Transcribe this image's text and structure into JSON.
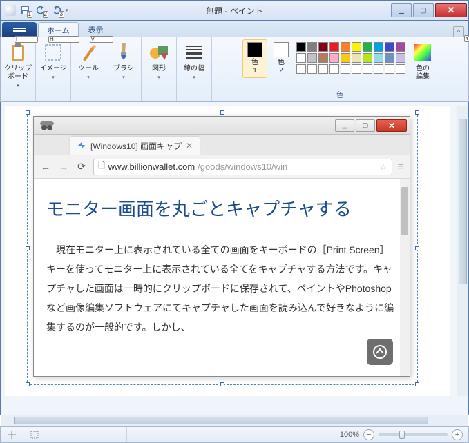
{
  "window": {
    "title": "無題 - ペイント",
    "qat": {
      "save_badge": "1",
      "undo_badge": "2",
      "redo_badge": "3"
    }
  },
  "tabs": {
    "file_badge": "F",
    "home": "ホーム",
    "home_badge": "H",
    "view": "表示",
    "view_badge": "V",
    "help_badge": "Y"
  },
  "ribbon": {
    "clipboard": {
      "label": "クリップ\nボード"
    },
    "image": {
      "label": "イメージ"
    },
    "tools": {
      "label": "ツール"
    },
    "brushes": {
      "label": "ブラシ"
    },
    "shapes": {
      "label": "図形"
    },
    "stroke": {
      "label": "線の幅"
    },
    "color1": {
      "label": "色\n1"
    },
    "color2": {
      "label": "色\n2"
    },
    "palette_label": "色",
    "edit_colors": {
      "label": "色の\n編集"
    },
    "palette": [
      [
        "#000000",
        "#7f7f7f",
        "#880015",
        "#ed1c24",
        "#ff7f27",
        "#fff200",
        "#22b14c",
        "#00a2e8",
        "#3f48cc",
        "#a349a4"
      ],
      [
        "#ffffff",
        "#c3c3c3",
        "#b97a57",
        "#ffaec9",
        "#ffc90e",
        "#efe4b0",
        "#b5e61d",
        "#99d9ea",
        "#7092be",
        "#c8bfe7"
      ],
      [
        "#ffffff",
        "#ffffff",
        "#ffffff",
        "#ffffff",
        "#ffffff",
        "#ffffff",
        "#ffffff",
        "#ffffff",
        "#ffffff",
        "#ffffff"
      ]
    ],
    "color1_value": "#000000",
    "color2_value": "#ffffff"
  },
  "browser": {
    "tab_title": "[Windows10] 画面キャプ",
    "url_host": "www.billionwallet.com",
    "url_path": "/goods/windows10/win",
    "heading": "モニター画面を丸ごとキャプチャする",
    "paragraph": "現在モニター上に表示されている全ての画面をキーボードの［Print Screen］キーを使ってモニター上に表示されている全てをキャプチャする方法です。キャプチャした画面は一時的にクリップボードに保存されて、ペイントやPhotoshopなど画像編集ソフトウェアにてキャプチャした画面を読み込んで好きなように編集するのが一般的です。しかし、"
  },
  "status": {
    "zoom": "100%"
  }
}
